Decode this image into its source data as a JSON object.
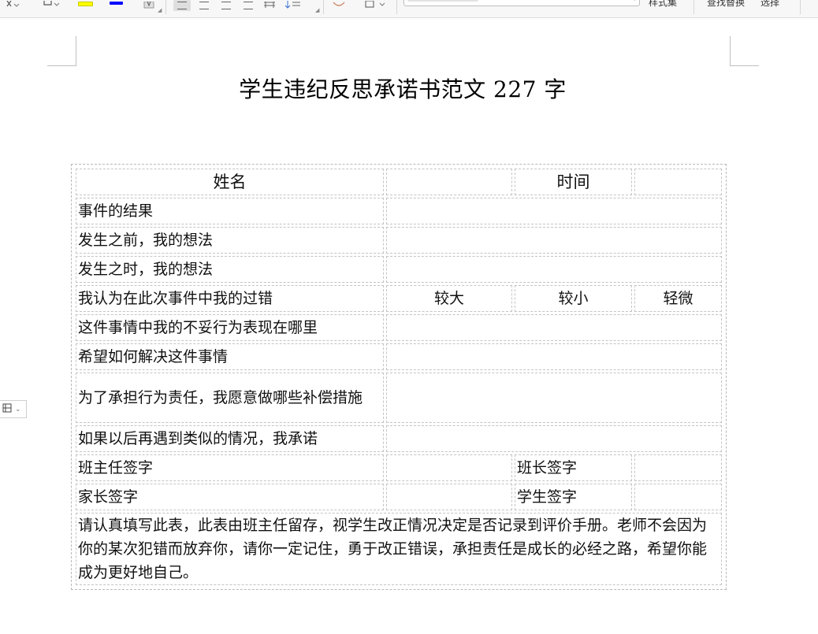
{
  "toolbar": {
    "icons": [
      "font-size-icon",
      "clear-format-icon",
      "highlight-color-icon",
      "font-color-icon",
      "char-shading-icon",
      "align-left-icon",
      "align-center-icon",
      "align-right-icon",
      "justify-icon",
      "distributed-icon",
      "line-spacing-icon",
      "link-icon",
      "border-icon"
    ],
    "highlight_color": "#ffff00",
    "font_color": "#0000ff",
    "style_gallery_label": "样式集",
    "find_replace_label": "查找替换",
    "select_label": "选择"
  },
  "gutter": {
    "icon": "table-handle-icon",
    "arrow": "chevron-down-icon"
  },
  "document": {
    "title": "学生违纪反思承诺书范文 227 字",
    "form": {
      "name_label": "姓名",
      "name_value": "",
      "time_label": "时间",
      "time_value": "",
      "result_label": "事件的结果",
      "result_value": "",
      "before_label": "发生之前，我的想法",
      "before_value": "",
      "during_label": "发生之时，我的想法",
      "during_value": "",
      "fault_label": "我认为在此次事件中我的过错",
      "fault_options": [
        "较大",
        "较小",
        "轻微"
      ],
      "improper_label": "这件事情中我的不妥行为表现在哪里",
      "improper_value": "",
      "solve_label": "希望如何解决这件事情",
      "solve_value": "",
      "compensate_label": "为了承担行为责任，我愿意做哪些补偿措施",
      "compensate_value": "",
      "promise_label": "如果以后再遇到类似的情况，我承诺",
      "promise_value": "",
      "teacher_sign_label": "班主任签字",
      "teacher_sign_value": "",
      "monitor_sign_label": "班长签字",
      "monitor_sign_value": "",
      "parent_sign_label": "家长签字",
      "parent_sign_value": "",
      "student_sign_label": "学生签字",
      "student_sign_value": "",
      "note": "请认真填写此表，此表由班主任留存，视学生改正情况决定是否记录到评价手册。老师不会因为你的某次犯错而放弃你，请你一定记住，勇于改正错误，承担责任是成长的必经之路，希望你能成为更好地自己。"
    }
  }
}
